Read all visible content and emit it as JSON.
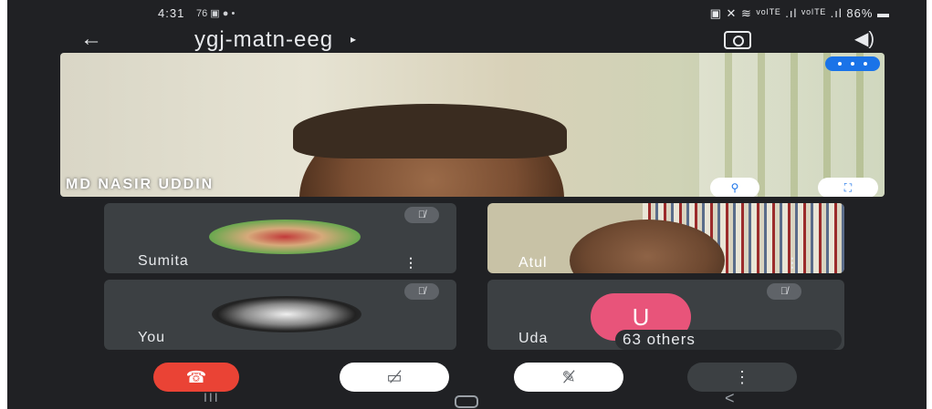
{
  "status_bar": {
    "time": "4:31",
    "left_icons": "76 ▣ ●  •",
    "right_text": "▣ ✕ ≋ ᵛᵒˡᵀᴱ .ıl ᵛᵒˡᵀᴱ .ıl 86% ▬"
  },
  "header": {
    "back_glyph": "←",
    "meeting_code": "ygj-matn-eeg",
    "caret_glyph": "▸",
    "speaker_glyph": "◀)"
  },
  "main_tile": {
    "name": "MD NASIR UDDIN",
    "pin_glyph": "⚲",
    "expand_glyph": "⛶"
  },
  "tiles": {
    "sumita": {
      "name": "Sumita",
      "mic_glyph": "🎙̸",
      "menu_glyph": "⋮"
    },
    "atul": {
      "name": "Atul",
      "menu_glyph": "⋮"
    },
    "you": {
      "name": "You",
      "mic_glyph": "🎙̸"
    },
    "uday": {
      "name": "Uda",
      "avatar_letter": "U",
      "others": "63 others",
      "mic_glyph": "🎙̸"
    }
  },
  "controls": {
    "end_call_glyph": "☎",
    "camera_glyph": "▭̸",
    "mic_glyph": "✎̸",
    "more_glyph": "⋮"
  },
  "navbar": {
    "recents_glyph": "III",
    "back_glyph": "<"
  },
  "colors": {
    "background": "#202124",
    "tile": "#3c4043",
    "end_call": "#ea4335",
    "avatar_pink": "#e8547a",
    "accent_blue": "#1a73e8"
  }
}
